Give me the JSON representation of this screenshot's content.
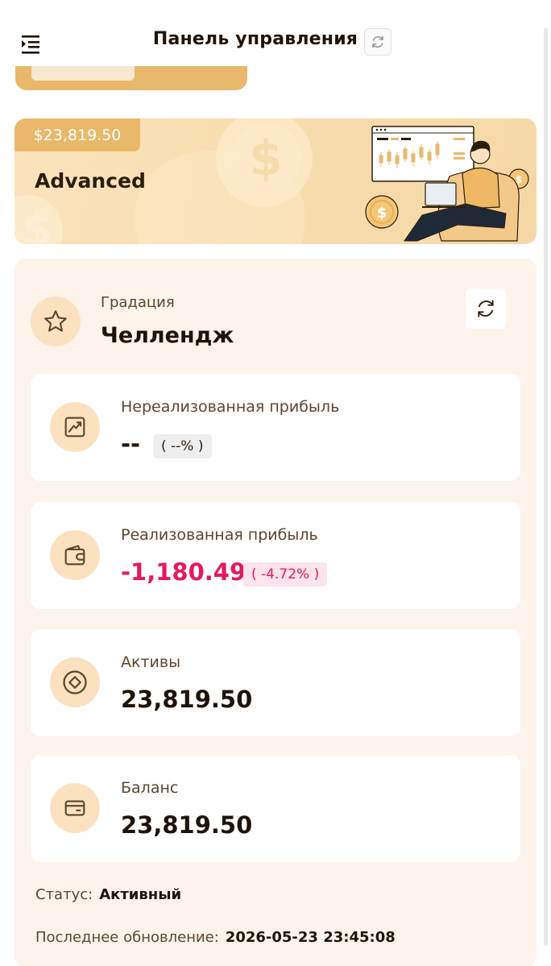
{
  "header": {
    "title": "Панель управления"
  },
  "banner": {
    "price": "$23,819.50",
    "label": "Advanced"
  },
  "gradation": {
    "label": "Градация",
    "value": "Челлендж"
  },
  "stats": [
    {
      "label": "Нереализованная прибыль",
      "value": "--",
      "percent": "( --% )",
      "tone": "neutral",
      "icon": "trend-chart-icon"
    },
    {
      "label": "Реализованная прибыль",
      "value": "-1,180.49",
      "percent": "( -4.72% )",
      "tone": "negative",
      "icon": "wallet-icon"
    },
    {
      "label": "Активы",
      "value": "23,819.50",
      "icon": "diamond-coin-icon"
    },
    {
      "label": "Баланс",
      "value": "23,819.50",
      "icon": "card-icon"
    }
  ],
  "status": {
    "label": "Статус:",
    "value": "Активный"
  },
  "last_update": {
    "label": "Последнее обновление:",
    "value": "2026-05-23 23:45:08"
  },
  "colors": {
    "accent": "#eab86b",
    "negative": "#e5195d",
    "card_bg": "#fcf3ea",
    "icon_bg": "#fbe1bf"
  }
}
